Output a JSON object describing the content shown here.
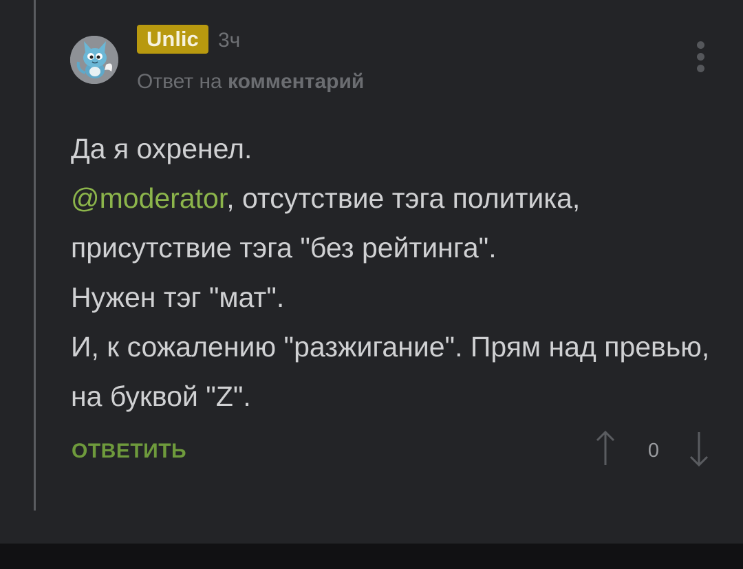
{
  "comment": {
    "username": "Unlic",
    "time": "3ч",
    "reply_prefix": "Ответ на",
    "reply_link": "комментарий",
    "body": {
      "line1": "Да я охренел.",
      "mention": "@moderator",
      "line2_rest": ", отсутствие тэга политика, присутствие тэга \"без рейтинга\".",
      "line3": "Нужен тэг \"мат\".",
      "line4": "И, к сожалению \"разжигание\". Прям над превью, на буквой \"Z\"."
    },
    "reply_button": "ОТВЕТИТЬ",
    "rating": "0"
  },
  "colors": {
    "background": "#232427",
    "username_badge": "#b8990f",
    "mention": "#8cb54b",
    "reply_button": "#6e9a3c",
    "text": "#d0d1d3",
    "muted": "#6b6d71"
  },
  "icons": {
    "avatar": "cat-avatar",
    "menu": "more-vertical-icon",
    "upvote": "arrow-up-icon",
    "downvote": "arrow-down-icon"
  }
}
